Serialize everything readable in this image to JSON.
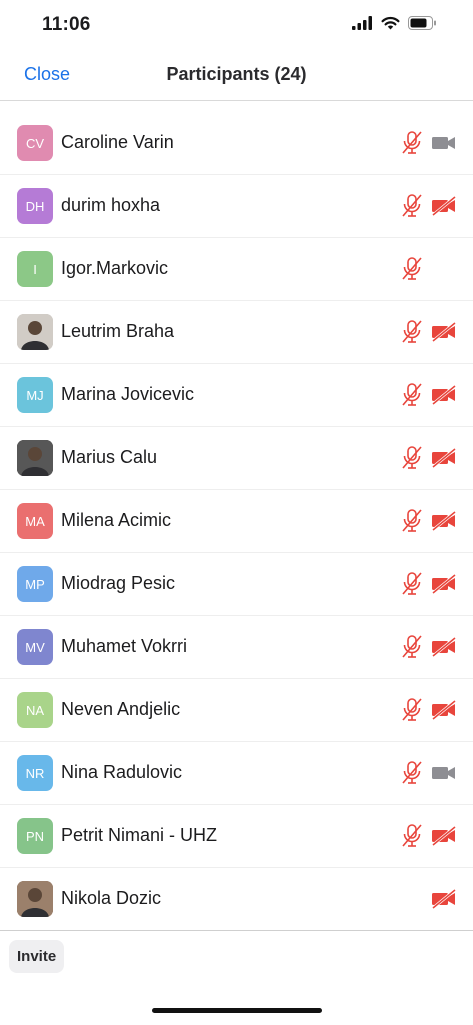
{
  "status_bar": {
    "time": "11:06"
  },
  "nav": {
    "close_label": "Close",
    "title": "Participants (24)"
  },
  "participants": [
    {
      "initials": "CV",
      "name": "Caroline Varin",
      "avatar_color": "#e08bb0",
      "photo": false,
      "mic": "muted",
      "video": "on"
    },
    {
      "initials": "DH",
      "name": "durim hoxha",
      "avatar_color": "#b57bd6",
      "photo": false,
      "mic": "muted",
      "video": "off"
    },
    {
      "initials": "I",
      "name": "Igor.Markovic",
      "avatar_color": "#8cc887",
      "photo": false,
      "mic": "muted",
      "video": "none"
    },
    {
      "initials": "",
      "name": "Leutrim Braha",
      "avatar_color": "#c9c3bd",
      "photo": true,
      "mic": "muted",
      "video": "off"
    },
    {
      "initials": "MJ",
      "name": "Marina Jovicevic",
      "avatar_color": "#6bc4dc",
      "photo": false,
      "mic": "muted",
      "video": "off"
    },
    {
      "initials": "",
      "name": "Marius Calu",
      "avatar_color": "#3a3a3a",
      "photo": true,
      "mic": "muted",
      "video": "off"
    },
    {
      "initials": "MA",
      "name": "Milena Acimic",
      "avatar_color": "#ea6f6f",
      "photo": false,
      "mic": "muted",
      "video": "off"
    },
    {
      "initials": "MP",
      "name": "Miodrag Pesic",
      "avatar_color": "#6fa9ea",
      "photo": false,
      "mic": "muted",
      "video": "off"
    },
    {
      "initials": "MV",
      "name": "Muhamet Vokrri",
      "avatar_color": "#7f86cf",
      "photo": false,
      "mic": "muted",
      "video": "off"
    },
    {
      "initials": "NA",
      "name": "Neven Andjelic",
      "avatar_color": "#a9d48a",
      "photo": false,
      "mic": "muted",
      "video": "off"
    },
    {
      "initials": "NR",
      "name": "Nina Radulovic",
      "avatar_color": "#68b8ea",
      "photo": false,
      "mic": "muted",
      "video": "on"
    },
    {
      "initials": "PN",
      "name": "Petrit Nimani - UHZ",
      "avatar_color": "#86c48a",
      "photo": false,
      "mic": "muted",
      "video": "off"
    },
    {
      "initials": "",
      "name": "Nikola Dozic",
      "avatar_color": "#8a6a52",
      "photo": true,
      "mic": "none",
      "video": "off"
    }
  ],
  "bottom": {
    "invite_label": "Invite"
  },
  "colors": {
    "accent": "#1b72e8",
    "muted_red": "#e8453c",
    "video_on_gray": "#8e8e93"
  }
}
